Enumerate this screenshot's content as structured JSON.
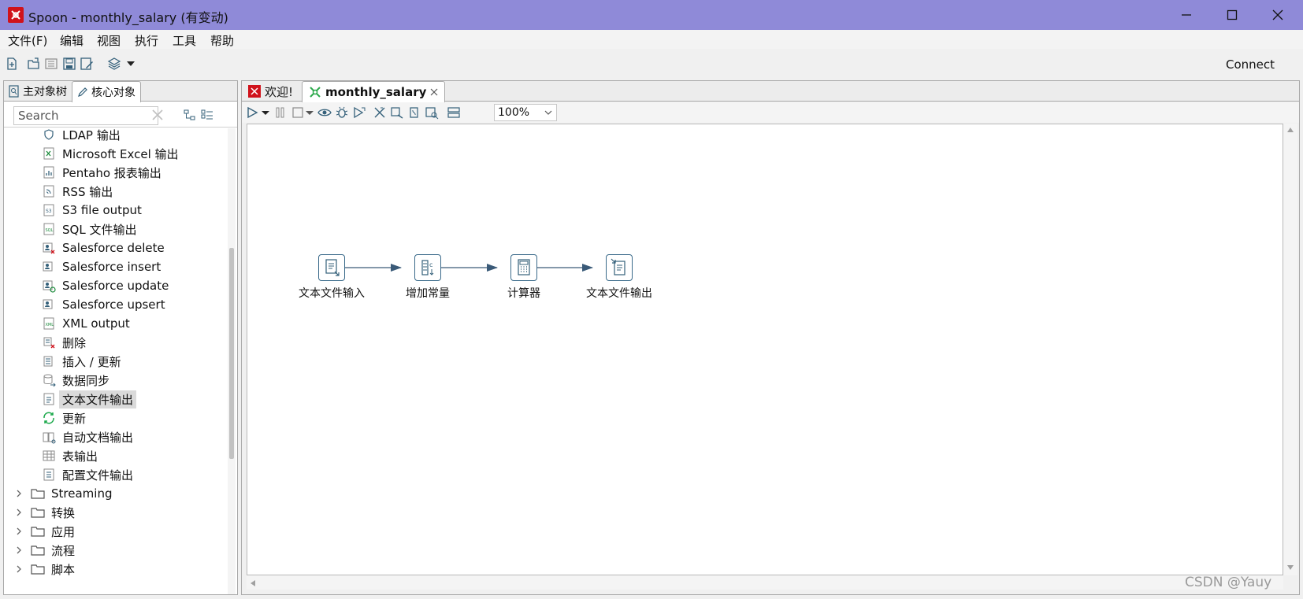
{
  "window": {
    "title": "Spoon - monthly_salary (有变动)",
    "minimize_icon": "minimize-icon",
    "maximize_icon": "maximize-icon",
    "close_icon": "close-icon"
  },
  "menu": [
    "文件(F)",
    "编辑",
    "视图",
    "执行",
    "工具",
    "帮助"
  ],
  "toolbar": {
    "connect_label": "Connect"
  },
  "left_panel": {
    "tabs": [
      "主对象树",
      "核心对象"
    ],
    "search_placeholder": "Search",
    "tree_items": [
      "LDAP 输出",
      "Microsoft Excel 输出",
      "Pentaho 报表输出",
      "RSS 输出",
      "S3 file output",
      "SQL 文件输出",
      "Salesforce delete",
      "Salesforce insert",
      "Salesforce update",
      "Salesforce upsert",
      "XML output",
      "删除",
      "插入 / 更新",
      "数据同步",
      "文本文件输出",
      "更新",
      "自动文档输出",
      "表输出",
      "配置文件输出"
    ],
    "selected_item": "文本文件输出",
    "folders": [
      "Streaming",
      "转换",
      "应用",
      "流程",
      "脚本"
    ]
  },
  "right_panel": {
    "tabs": [
      "欢迎!",
      "monthly_salary"
    ],
    "zoom": "100%",
    "steps": [
      "文本文件输入",
      "增加常量",
      "计算器",
      "文本文件输出"
    ]
  },
  "watermark": "CSDN @Yauy",
  "colors": {
    "titlebar": "#8f8ad8",
    "hop": "#3a5a78",
    "step_border": "#3a6a8a",
    "spoon_red": "#d0121b",
    "tab_green": "#2aa84a"
  }
}
